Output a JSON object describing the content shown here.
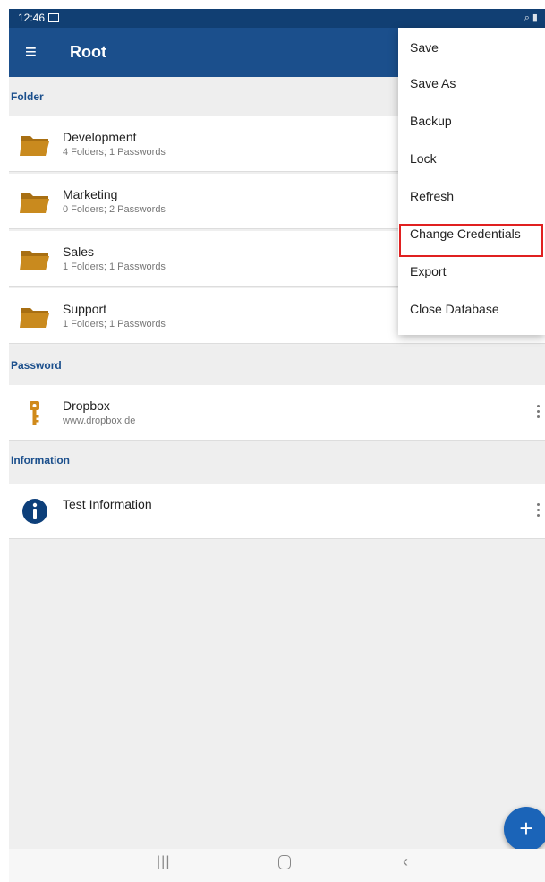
{
  "status_bar": {
    "time": "12:46",
    "system_icons": "⌕ ▮"
  },
  "app_bar": {
    "title": "Root"
  },
  "sections": {
    "folder": "Folder",
    "password": "Password",
    "information": "Information"
  },
  "folders": [
    {
      "name": "Development",
      "detail": "4 Folders; 1 Passwords"
    },
    {
      "name": "Marketing",
      "detail": "0 Folders; 2 Passwords"
    },
    {
      "name": "Sales",
      "detail": "1 Folders; 1 Passwords"
    },
    {
      "name": "Support",
      "detail": "1 Folders; 1 Passwords"
    }
  ],
  "passwords": [
    {
      "name": "Dropbox",
      "url": "www.dropbox.de"
    }
  ],
  "information": [
    {
      "name": "Test Information"
    }
  ],
  "overflow_menu": {
    "items": [
      "Save",
      "Save As",
      "Backup",
      "Lock",
      "Refresh",
      "Change Credentials",
      "Export",
      "Close Database"
    ],
    "highlighted": "Change Credentials"
  },
  "fab": {
    "label": "+"
  },
  "colors": {
    "primary": "#1b4f8c",
    "status_bar": "#113f73",
    "folder_icon": "#c98a1e",
    "key_icon": "#d08a1a",
    "info_icon": "#0d3f7a",
    "highlight_border": "#e02020",
    "fab": "#1b64b8"
  }
}
